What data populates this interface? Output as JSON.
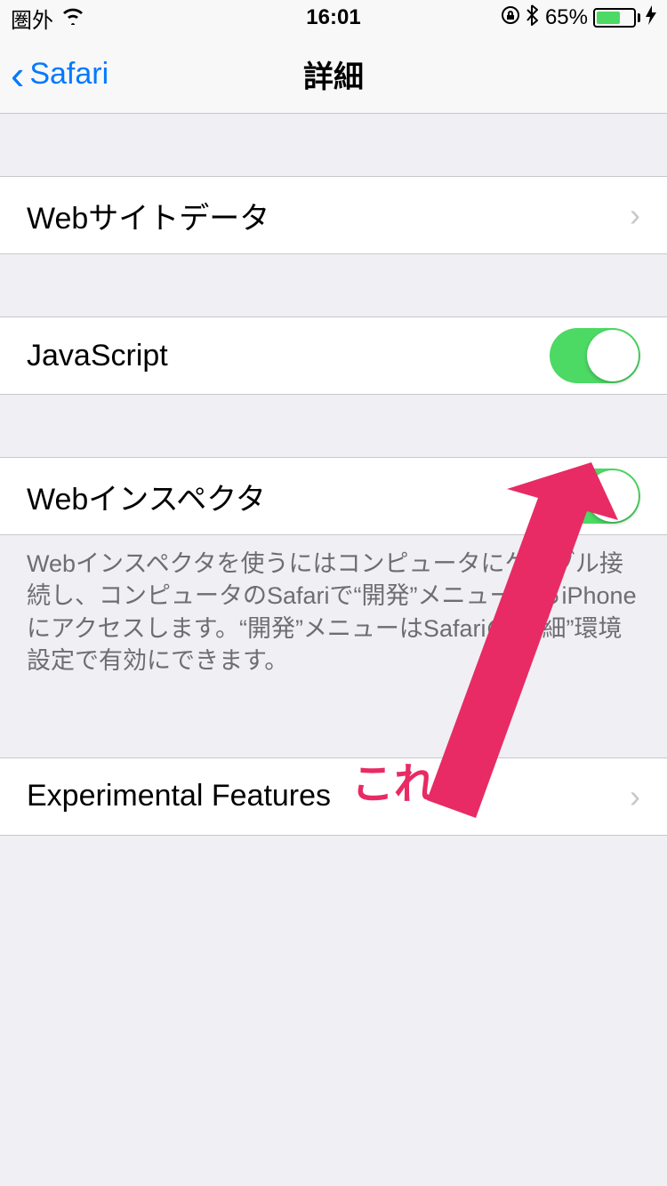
{
  "status": {
    "carrier": "圏外",
    "time": "16:01",
    "battery_percent": "65%",
    "battery_level": 65
  },
  "nav": {
    "back_label": "Safari",
    "title": "詳細"
  },
  "rows": {
    "website_data": "Webサイトデータ",
    "javascript": "JavaScript",
    "web_inspector": "Webインスペクタ",
    "experimental": "Experimental Features"
  },
  "toggles": {
    "javascript_on": true,
    "web_inspector_on": true
  },
  "footer": {
    "inspector_note": "Webインスペクタを使うにはコンピュータにケーブル接続し、コンピュータのSafariで“開発”メニューからiPhoneにアクセスします。“開発”メニューはSafariの“詳細”環境設定で有効にできます。"
  },
  "annotation": {
    "label": "これ",
    "color": "#e82b64"
  }
}
